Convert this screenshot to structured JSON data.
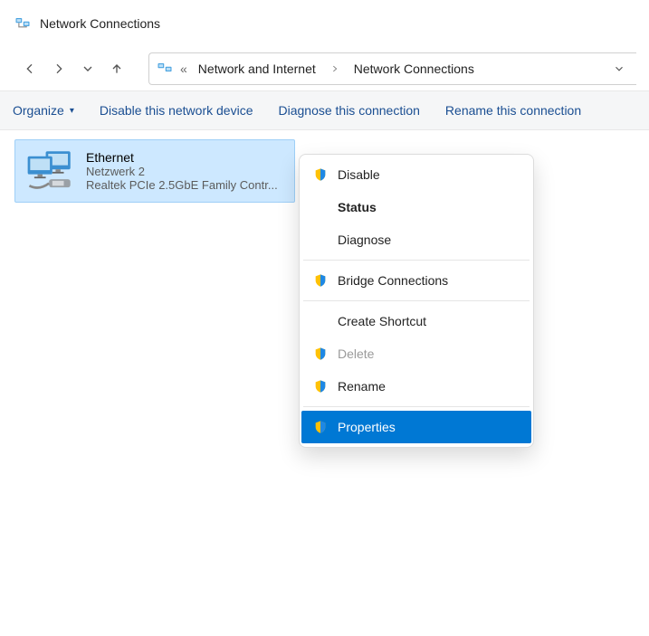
{
  "window": {
    "title": "Network Connections"
  },
  "breadcrumb": {
    "prefix": "«",
    "items": [
      "Network and Internet",
      "Network Connections"
    ]
  },
  "toolbar": {
    "organize": "Organize",
    "disable_device": "Disable this network device",
    "diagnose": "Diagnose this connection",
    "rename": "Rename this connection"
  },
  "adapter": {
    "name": "Ethernet",
    "network": "Netzwerk 2",
    "device": "Realtek PCIe 2.5GbE Family Contr..."
  },
  "context_menu": {
    "disable": "Disable",
    "status": "Status",
    "diagnose": "Diagnose",
    "bridge": "Bridge Connections",
    "shortcut": "Create Shortcut",
    "delete": "Delete",
    "rename": "Rename",
    "properties": "Properties"
  }
}
